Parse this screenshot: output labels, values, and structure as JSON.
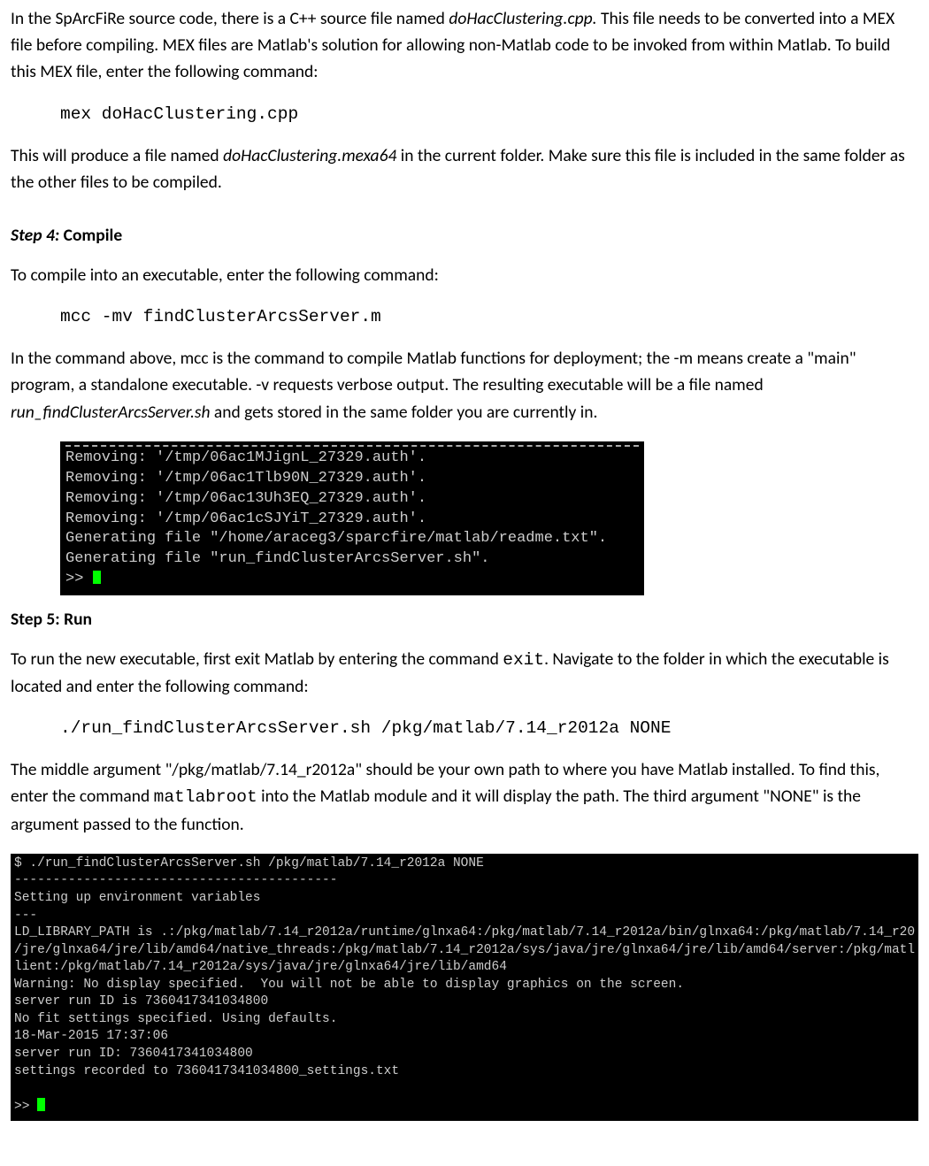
{
  "p1": {
    "t1": "In the SpArcFiRe source code, there is a C++ source file named ",
    "em1": "doHacClustering.cpp.",
    "t2": " This file needs to be converted into a MEX file before compiling. MEX files are Matlab's solution for allowing non-Matlab code to be invoked from within Matlab. To build this MEX file, enter the following command:"
  },
  "cmd1": "mex doHacClustering.cpp",
  "p2": {
    "t1": "This will produce a file named ",
    "em1": "doHacClustering.mexa64",
    "t2": " in the current folder. Make sure this file is included in the same folder as the other files to be compiled."
  },
  "step4": {
    "label": "Step 4:",
    "title": " Compile"
  },
  "p3": "To compile into an executable, enter the following command:",
  "cmd2": "mcc -mv findClusterArcsServer.m",
  "p4": {
    "t1": "In the command above, mcc is the command to compile Matlab functions for deployment; the -m means create a \"main\" program, a standalone executable. -v requests verbose output. The resulting executable will be a file named ",
    "em1": "run_findClusterArcsServer.sh",
    "t2": " and gets stored in the same folder you are currently in."
  },
  "term1": {
    "l1": "Removing: '/tmp/06ac1MJignL_27329.auth'.",
    "l2": "Removing: '/tmp/06ac1Tlb90N_27329.auth'.",
    "l3": "Removing: '/tmp/06ac13Uh3EQ_27329.auth'.",
    "l4": "Removing: '/tmp/06ac1cSJYiT_27329.auth'.",
    "l5": "Generating file \"/home/araceg3/sparcfire/matlab/readme.txt\".",
    "l6": "Generating file \"run_findClusterArcsServer.sh\".",
    "prompt": ">> "
  },
  "step5": {
    "full": "Step 5: Run"
  },
  "p5": {
    "t1": "To run the new executable, first exit Matlab by entering the command ",
    "cmd": "exit",
    "t2": ". Navigate to the folder in which the executable is located and enter the following command:"
  },
  "cmd3": "./run_findClusterArcsServer.sh /pkg/matlab/7.14_r2012a NONE",
  "p6": {
    "t1": "The middle argument \"/pkg/matlab/7.14_r2012a\" should be your own path to where you have Matlab installed. To find this, enter the command ",
    "cmd": "matlabroot",
    "t2": " into the Matlab module and it will display the path. The third argument \"NONE\" is the argument passed to the function."
  },
  "term2": {
    "l1": "$ ./run_findClusterArcsServer.sh /pkg/matlab/7.14_r2012a NONE",
    "l2": "------------------------------------------",
    "l3": "Setting up environment variables",
    "l4": "---",
    "l5": "LD_LIBRARY_PATH is .:/pkg/matlab/7.14_r2012a/runtime/glnxa64:/pkg/matlab/7.14_r2012a/bin/glnxa64:/pkg/matlab/7.14_r20",
    "l6": "/jre/glnxa64/jre/lib/amd64/native_threads:/pkg/matlab/7.14_r2012a/sys/java/jre/glnxa64/jre/lib/amd64/server:/pkg/matl",
    "l7": "lient:/pkg/matlab/7.14_r2012a/sys/java/jre/glnxa64/jre/lib/amd64",
    "l8": "Warning: No display specified.  You will not be able to display graphics on the screen.",
    "l9": "server run ID is 7360417341034800",
    "l10": "No fit settings specified. Using defaults.",
    "l11": "18-Mar-2015 17:37:06",
    "l12": "server run ID: 7360417341034800",
    "l13": "settings recorded to 7360417341034800_settings.txt",
    "blank": " ",
    "prompt": ">> "
  }
}
